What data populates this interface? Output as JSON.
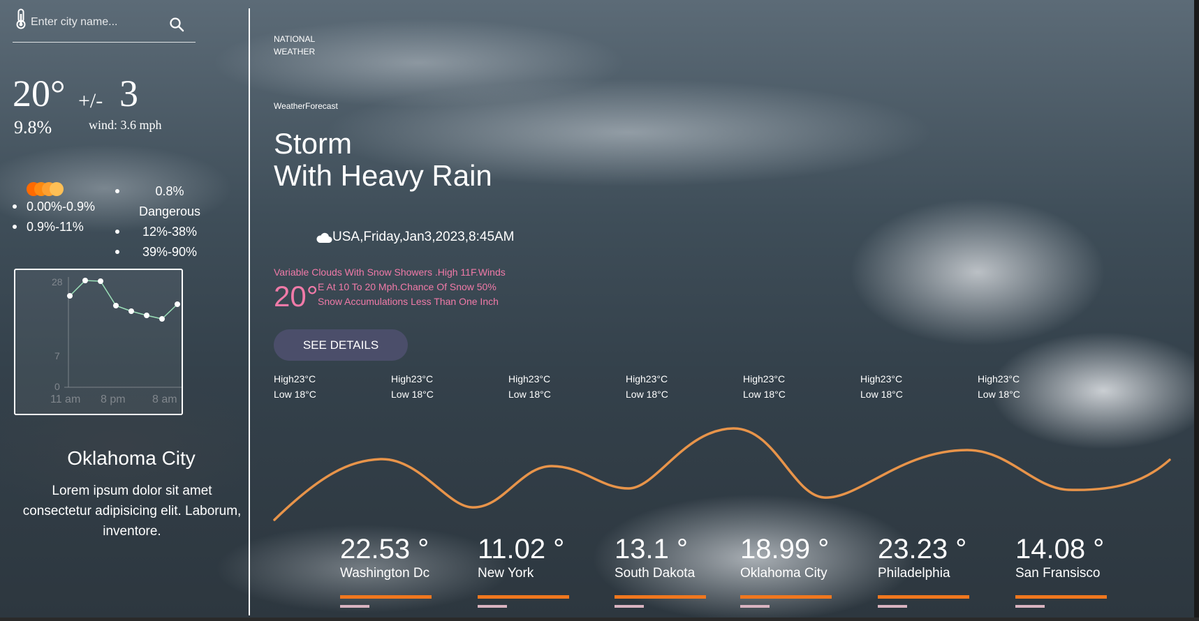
{
  "search": {
    "placeholder": "Enter city name..."
  },
  "current": {
    "temp": "20°",
    "plus_minus": "+/-",
    "variance": "3",
    "humidity": "9.8%",
    "wind": "wind: 3.6 mph"
  },
  "legend": {
    "left": [
      "0.00%-0.9%",
      "0.9%-11%"
    ],
    "right": [
      "0.8%",
      "Dangerous",
      "12%-38%",
      "39%-90%"
    ],
    "bubble_colors": [
      "#ff6a00",
      "#ff8a10",
      "#ffa030",
      "#ffbf55"
    ]
  },
  "mini_chart": {
    "y_ticks": [
      "28",
      "7",
      "0"
    ],
    "x_ticks": [
      "11 am",
      "8 pm",
      "8 am"
    ]
  },
  "city": {
    "name": "Oklahoma City",
    "description": "Lorem ipsum dolor sit amet consectetur adipisicing elit. Laborum, inventore."
  },
  "header": {
    "national": "NATIONAL WEATHER",
    "weather_forecast": "WeatherForecast"
  },
  "headline": {
    "line1": "Storm",
    "line2": "With Heavy Rain"
  },
  "dateline": "USA,Friday,Jan3,2023,8:45AM",
  "forecast": {
    "temp": "20°",
    "line1": "Variable Clouds With Snow Showers .High 11F.Winds",
    "line2": "E At 10 To 20 Mph.Chance Of Snow 50%",
    "line3": "Snow Accumulations Less Than One Inch"
  },
  "see_details_label": "SEE DETAILS",
  "highlow": [
    {
      "high": "High23°C",
      "low": "Low 18°C"
    },
    {
      "high": "High23°C",
      "low": "Low 18°C"
    },
    {
      "high": "High23°C",
      "low": "Low 18°C"
    },
    {
      "high": "High23°C",
      "low": "Low 18°C"
    },
    {
      "high": "High23°C",
      "low": "Low 18°C"
    },
    {
      "high": "High23°C",
      "low": "Low 18°C"
    },
    {
      "high": "High23°C",
      "low": "Low 18°C"
    }
  ],
  "cities": [
    {
      "temp": "22.53 °",
      "name": "Washington Dc"
    },
    {
      "temp": "11.02 °",
      "name": "New York"
    },
    {
      "temp": "13.1 °",
      "name": "South Dakota"
    },
    {
      "temp": "18.99 °",
      "name": "Oklahoma City"
    },
    {
      "temp": "23.23 °",
      "name": "Philadelphia"
    },
    {
      "temp": "14.08 °",
      "name": "San Fransisco"
    }
  ],
  "colors": {
    "accent": "#f0771e",
    "wave": "#e8944a",
    "pink": "#f07aa8",
    "chart_line": "#9be0b8"
  }
}
